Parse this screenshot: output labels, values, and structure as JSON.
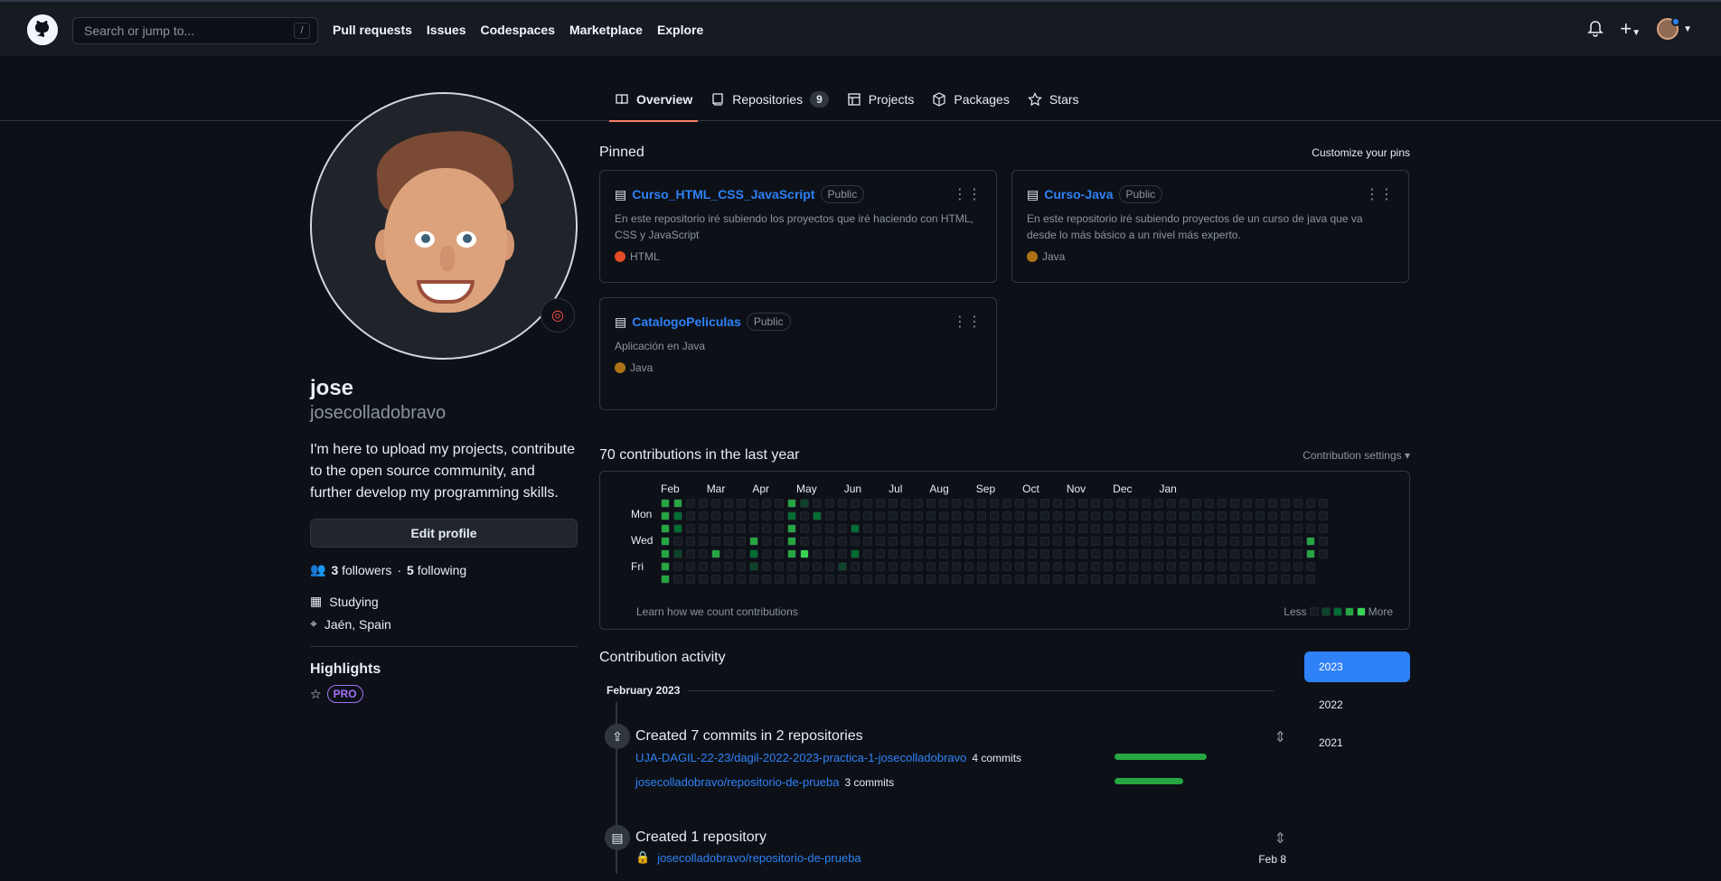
{
  "topbar": {
    "search_placeholder": "Search or jump to...",
    "slash": "/",
    "links": [
      "Pull requests",
      "Issues",
      "Codespaces",
      "Marketplace",
      "Explore"
    ]
  },
  "tabs": [
    {
      "label": "Overview",
      "icon": "book-icon"
    },
    {
      "label": "Repositories",
      "count": "9",
      "icon": "repo-icon"
    },
    {
      "label": "Projects",
      "icon": "table-icon"
    },
    {
      "label": "Packages",
      "icon": "package-icon"
    },
    {
      "label": "Stars",
      "icon": "star-icon"
    }
  ],
  "profile": {
    "name": "jose",
    "username": "josecolladobravo",
    "bio": "I'm here to upload my projects, contribute to the open source community, and further develop my programming skills.",
    "edit_label": "Edit profile",
    "followers": "3",
    "followers_label": "followers",
    "following": "5",
    "following_label": "following",
    "company": "Studying",
    "location": "Jaén, Spain",
    "highlights_title": "Highlights",
    "pro_label": "PRO",
    "status_icon": "target-icon"
  },
  "pinned": {
    "title": "Pinned",
    "customize": "Customize your pins",
    "repos": [
      {
        "name": "Curso_HTML_CSS_JavaScript",
        "visibility": "Public",
        "description": "En este repositorio iré subiendo los proyectos que iré haciendo con HTML, CSS y JavaScript",
        "language": "HTML",
        "language_color": "#e34c26"
      },
      {
        "name": "Curso-Java",
        "visibility": "Public",
        "description": "En este repositorio iré subiendo proyectos de un curso de java que va desde lo más básico a un nivel más experto.",
        "language": "Java",
        "language_color": "#b07219"
      },
      {
        "name": "CatalogoPeliculas",
        "visibility": "Public",
        "description": "Aplicación en Java",
        "language": "Java",
        "language_color": "#b07219"
      }
    ]
  },
  "contributions": {
    "title": "70 contributions in the last year",
    "settings": "Contribution settings ▾",
    "months": [
      "Feb",
      "Mar",
      "Apr",
      "May",
      "Jun",
      "Jul",
      "Aug",
      "Sep",
      "Oct",
      "Nov",
      "Dec",
      "Jan"
    ],
    "days": [
      "Mon",
      "Wed",
      "Fri"
    ],
    "learn": "Learn how we count contributions",
    "less": "Less",
    "more": "More"
  },
  "activity": {
    "title": "Contribution activity",
    "month": "February 2023",
    "years": [
      "2023",
      "2022",
      "2021"
    ],
    "event1_title": "Created 7 commits in 2 repositories",
    "repo1": "UJA-DAGIL-22-23/dagil-2022-2023-practica-1-josecolladobravo",
    "repo1_count": "4 commits",
    "repo2": "josecolladobravo/repositorio-de-prueba",
    "repo2_count": "3 commits",
    "event2_title": "Created 1 repository",
    "created_repo": "josecolladobravo/repositorio-de-prueba",
    "created_date": "Feb 8"
  }
}
